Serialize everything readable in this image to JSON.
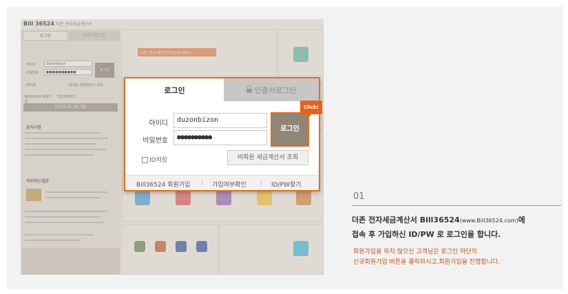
{
  "mini": {
    "brand": "Bill 36524",
    "brand_sub": "더존 전자세금계산서",
    "tab_login": "로그인",
    "tab_cert": "인증서로그인",
    "id_label": "아이디",
    "id_value": "duzonbizon",
    "pw_label": "비밀번호",
    "pw_value": "●●●●●●●●●●",
    "login_btn": "로그인",
    "idsave": "ID저장",
    "nonmember": "비회원 세금계산서 조회",
    "links": [
      "Bill36524 회원가입",
      "가입여부확인",
      "ID/PW찾기"
    ],
    "date": "2014.05.19 (월)",
    "notice": "공지사항",
    "faq": "자주하는질문",
    "banner": "더존 전자계약/전자금융서비스"
  },
  "login": {
    "tab_login": "로그인",
    "tab_cert": "인증서로그인",
    "id_label": "아이디",
    "id_value": "duzonbizon",
    "pw_label": "비밀번호",
    "pw_value": "●●●●●●●●●●",
    "login_btn": "로그인",
    "click": "Click!",
    "idsave": "ID저장",
    "nonmember": "비회원 세금계산서 조회",
    "link_join": "Bill36524 회원가입",
    "link_check": "가입여부확인",
    "link_find": "ID/PW찾기"
  },
  "step": {
    "number": "01",
    "line1_a": "더존 전자세금계산서 Bill36524",
    "line1_url": "(www.Bill36524.com)",
    "line1_b": "에",
    "line2": "접속 후 가입하신 ID/PW 로 로그인을 합니다.",
    "note1": "회원가입을 하지 않으신 고객님은 로그인 하단의",
    "note2": "신규회원가입 버튼을 클릭하시고,회원가입을 진행합니다."
  },
  "colors": {
    "accent": "#e46f1d",
    "note": "#c0531b"
  }
}
